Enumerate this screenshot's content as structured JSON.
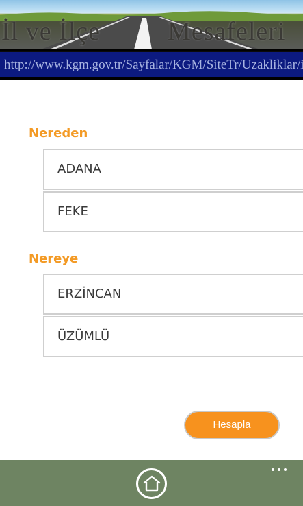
{
  "header": {
    "title_left": "İl ve İlçe",
    "title_right": "Mesafeleri",
    "url": "http://www.kgm.gov.tr/Sayfalar/KGM/SiteTr/Uzakliklar/ilce"
  },
  "form": {
    "from_label": "Nereden",
    "from_city": "ADANA",
    "from_district": "FEKE",
    "to_label": "Nereye",
    "to_city": "ERZİNCAN",
    "to_district": "ÜZÜMLÜ",
    "calculate_button": "Hesapla"
  },
  "app_bar": {
    "home_icon": "home-icon",
    "more_icon": "more-icon"
  },
  "colors": {
    "accent": "#f39a25",
    "button": "#f7921e",
    "app_bar": "#6e8462",
    "url_bar": "#0c1a80"
  }
}
